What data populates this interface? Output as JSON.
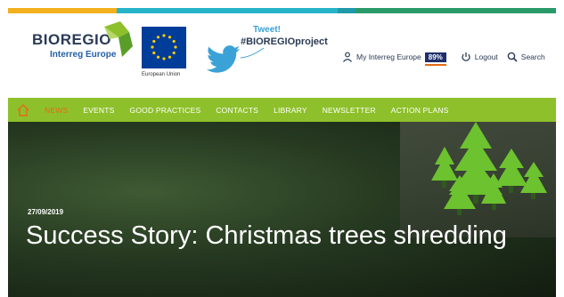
{
  "colors": {
    "stripe": [
      "#f2b01e",
      "#27b4c9",
      "#1e9aa8",
      "#2a9a6a"
    ],
    "nav_bg": "#8ec02b",
    "nav_active": "#e36a16",
    "brand_dark": "#2a3a55",
    "brand_blue": "#2560a8",
    "twitter_blue": "#3aa2d6",
    "eu_blue": "#003d99",
    "eu_star": "#ffcc00",
    "badge_bg": "#1e2f6b",
    "trees_green": "#6cc22f"
  },
  "logo": {
    "title": "BIOREGIO",
    "subtitle": "Interreg Europe",
    "mark_icon": "bioregio-leaf-icon"
  },
  "eu": {
    "label": "European Union",
    "flag_icon": "eu-flag-icon"
  },
  "tweet": {
    "title": "Tweet!",
    "hashtag": "#BIOREGIOproject",
    "icon": "twitter-bird-icon"
  },
  "user_nav": {
    "my_interreg_label": "My Interreg Europe",
    "completion": "89%",
    "logout_label": "Logout",
    "search_label": "Search",
    "user_icon": "user-icon",
    "logout_icon": "power-icon",
    "search_icon": "search-icon"
  },
  "nav": {
    "home_icon": "home-icon",
    "items": [
      "NEWS",
      "EVENTS",
      "GOOD PRACTICES",
      "CONTACTS",
      "LIBRARY",
      "NEWSLETTER",
      "ACTION PLANS"
    ],
    "active_index": 0
  },
  "hero": {
    "date": "27/09/2019",
    "title": "Success Story: Christmas trees shredding",
    "trees_icon": "christmas-trees-icon"
  }
}
